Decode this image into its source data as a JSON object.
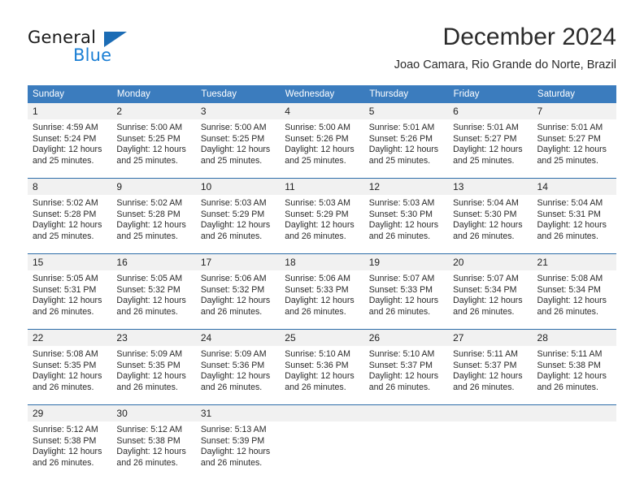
{
  "logo": {
    "word_one": "General",
    "word_two": "Blue",
    "triangle_icon": "blue-triangle-icon",
    "colors": {
      "general": "#1a1a1a",
      "blue": "#1b7fd4",
      "triangle": "#1b6cb5"
    }
  },
  "header": {
    "title": "December 2024",
    "subtitle": "Joao Camara, Rio Grande do Norte, Brazil"
  },
  "theme": {
    "header_blue": "#3b7cbe",
    "row_rule_blue": "#2c6ca8",
    "daynum_band": "#f1f1f1",
    "text": "#2a2a2a"
  },
  "weekdays": [
    "Sunday",
    "Monday",
    "Tuesday",
    "Wednesday",
    "Thursday",
    "Friday",
    "Saturday"
  ],
  "weeks": [
    [
      {
        "day": "1",
        "sunrise": "Sunrise: 4:59 AM",
        "sunset": "Sunset: 5:24 PM",
        "daylight_1": "Daylight: 12 hours",
        "daylight_2": "and 25 minutes."
      },
      {
        "day": "2",
        "sunrise": "Sunrise: 5:00 AM",
        "sunset": "Sunset: 5:25 PM",
        "daylight_1": "Daylight: 12 hours",
        "daylight_2": "and 25 minutes."
      },
      {
        "day": "3",
        "sunrise": "Sunrise: 5:00 AM",
        "sunset": "Sunset: 5:25 PM",
        "daylight_1": "Daylight: 12 hours",
        "daylight_2": "and 25 minutes."
      },
      {
        "day": "4",
        "sunrise": "Sunrise: 5:00 AM",
        "sunset": "Sunset: 5:26 PM",
        "daylight_1": "Daylight: 12 hours",
        "daylight_2": "and 25 minutes."
      },
      {
        "day": "5",
        "sunrise": "Sunrise: 5:01 AM",
        "sunset": "Sunset: 5:26 PM",
        "daylight_1": "Daylight: 12 hours",
        "daylight_2": "and 25 minutes."
      },
      {
        "day": "6",
        "sunrise": "Sunrise: 5:01 AM",
        "sunset": "Sunset: 5:27 PM",
        "daylight_1": "Daylight: 12 hours",
        "daylight_2": "and 25 minutes."
      },
      {
        "day": "7",
        "sunrise": "Sunrise: 5:01 AM",
        "sunset": "Sunset: 5:27 PM",
        "daylight_1": "Daylight: 12 hours",
        "daylight_2": "and 25 minutes."
      }
    ],
    [
      {
        "day": "8",
        "sunrise": "Sunrise: 5:02 AM",
        "sunset": "Sunset: 5:28 PM",
        "daylight_1": "Daylight: 12 hours",
        "daylight_2": "and 25 minutes."
      },
      {
        "day": "9",
        "sunrise": "Sunrise: 5:02 AM",
        "sunset": "Sunset: 5:28 PM",
        "daylight_1": "Daylight: 12 hours",
        "daylight_2": "and 25 minutes."
      },
      {
        "day": "10",
        "sunrise": "Sunrise: 5:03 AM",
        "sunset": "Sunset: 5:29 PM",
        "daylight_1": "Daylight: 12 hours",
        "daylight_2": "and 26 minutes."
      },
      {
        "day": "11",
        "sunrise": "Sunrise: 5:03 AM",
        "sunset": "Sunset: 5:29 PM",
        "daylight_1": "Daylight: 12 hours",
        "daylight_2": "and 26 minutes."
      },
      {
        "day": "12",
        "sunrise": "Sunrise: 5:03 AM",
        "sunset": "Sunset: 5:30 PM",
        "daylight_1": "Daylight: 12 hours",
        "daylight_2": "and 26 minutes."
      },
      {
        "day": "13",
        "sunrise": "Sunrise: 5:04 AM",
        "sunset": "Sunset: 5:30 PM",
        "daylight_1": "Daylight: 12 hours",
        "daylight_2": "and 26 minutes."
      },
      {
        "day": "14",
        "sunrise": "Sunrise: 5:04 AM",
        "sunset": "Sunset: 5:31 PM",
        "daylight_1": "Daylight: 12 hours",
        "daylight_2": "and 26 minutes."
      }
    ],
    [
      {
        "day": "15",
        "sunrise": "Sunrise: 5:05 AM",
        "sunset": "Sunset: 5:31 PM",
        "daylight_1": "Daylight: 12 hours",
        "daylight_2": "and 26 minutes."
      },
      {
        "day": "16",
        "sunrise": "Sunrise: 5:05 AM",
        "sunset": "Sunset: 5:32 PM",
        "daylight_1": "Daylight: 12 hours",
        "daylight_2": "and 26 minutes."
      },
      {
        "day": "17",
        "sunrise": "Sunrise: 5:06 AM",
        "sunset": "Sunset: 5:32 PM",
        "daylight_1": "Daylight: 12 hours",
        "daylight_2": "and 26 minutes."
      },
      {
        "day": "18",
        "sunrise": "Sunrise: 5:06 AM",
        "sunset": "Sunset: 5:33 PM",
        "daylight_1": "Daylight: 12 hours",
        "daylight_2": "and 26 minutes."
      },
      {
        "day": "19",
        "sunrise": "Sunrise: 5:07 AM",
        "sunset": "Sunset: 5:33 PM",
        "daylight_1": "Daylight: 12 hours",
        "daylight_2": "and 26 minutes."
      },
      {
        "day": "20",
        "sunrise": "Sunrise: 5:07 AM",
        "sunset": "Sunset: 5:34 PM",
        "daylight_1": "Daylight: 12 hours",
        "daylight_2": "and 26 minutes."
      },
      {
        "day": "21",
        "sunrise": "Sunrise: 5:08 AM",
        "sunset": "Sunset: 5:34 PM",
        "daylight_1": "Daylight: 12 hours",
        "daylight_2": "and 26 minutes."
      }
    ],
    [
      {
        "day": "22",
        "sunrise": "Sunrise: 5:08 AM",
        "sunset": "Sunset: 5:35 PM",
        "daylight_1": "Daylight: 12 hours",
        "daylight_2": "and 26 minutes."
      },
      {
        "day": "23",
        "sunrise": "Sunrise: 5:09 AM",
        "sunset": "Sunset: 5:35 PM",
        "daylight_1": "Daylight: 12 hours",
        "daylight_2": "and 26 minutes."
      },
      {
        "day": "24",
        "sunrise": "Sunrise: 5:09 AM",
        "sunset": "Sunset: 5:36 PM",
        "daylight_1": "Daylight: 12 hours",
        "daylight_2": "and 26 minutes."
      },
      {
        "day": "25",
        "sunrise": "Sunrise: 5:10 AM",
        "sunset": "Sunset: 5:36 PM",
        "daylight_1": "Daylight: 12 hours",
        "daylight_2": "and 26 minutes."
      },
      {
        "day": "26",
        "sunrise": "Sunrise: 5:10 AM",
        "sunset": "Sunset: 5:37 PM",
        "daylight_1": "Daylight: 12 hours",
        "daylight_2": "and 26 minutes."
      },
      {
        "day": "27",
        "sunrise": "Sunrise: 5:11 AM",
        "sunset": "Sunset: 5:37 PM",
        "daylight_1": "Daylight: 12 hours",
        "daylight_2": "and 26 minutes."
      },
      {
        "day": "28",
        "sunrise": "Sunrise: 5:11 AM",
        "sunset": "Sunset: 5:38 PM",
        "daylight_1": "Daylight: 12 hours",
        "daylight_2": "and 26 minutes."
      }
    ],
    [
      {
        "day": "29",
        "sunrise": "Sunrise: 5:12 AM",
        "sunset": "Sunset: 5:38 PM",
        "daylight_1": "Daylight: 12 hours",
        "daylight_2": "and 26 minutes."
      },
      {
        "day": "30",
        "sunrise": "Sunrise: 5:12 AM",
        "sunset": "Sunset: 5:38 PM",
        "daylight_1": "Daylight: 12 hours",
        "daylight_2": "and 26 minutes."
      },
      {
        "day": "31",
        "sunrise": "Sunrise: 5:13 AM",
        "sunset": "Sunset: 5:39 PM",
        "daylight_1": "Daylight: 12 hours",
        "daylight_2": "and 26 minutes."
      },
      {
        "day": "",
        "sunrise": "",
        "sunset": "",
        "daylight_1": "",
        "daylight_2": ""
      },
      {
        "day": "",
        "sunrise": "",
        "sunset": "",
        "daylight_1": "",
        "daylight_2": ""
      },
      {
        "day": "",
        "sunrise": "",
        "sunset": "",
        "daylight_1": "",
        "daylight_2": ""
      },
      {
        "day": "",
        "sunrise": "",
        "sunset": "",
        "daylight_1": "",
        "daylight_2": ""
      }
    ]
  ]
}
